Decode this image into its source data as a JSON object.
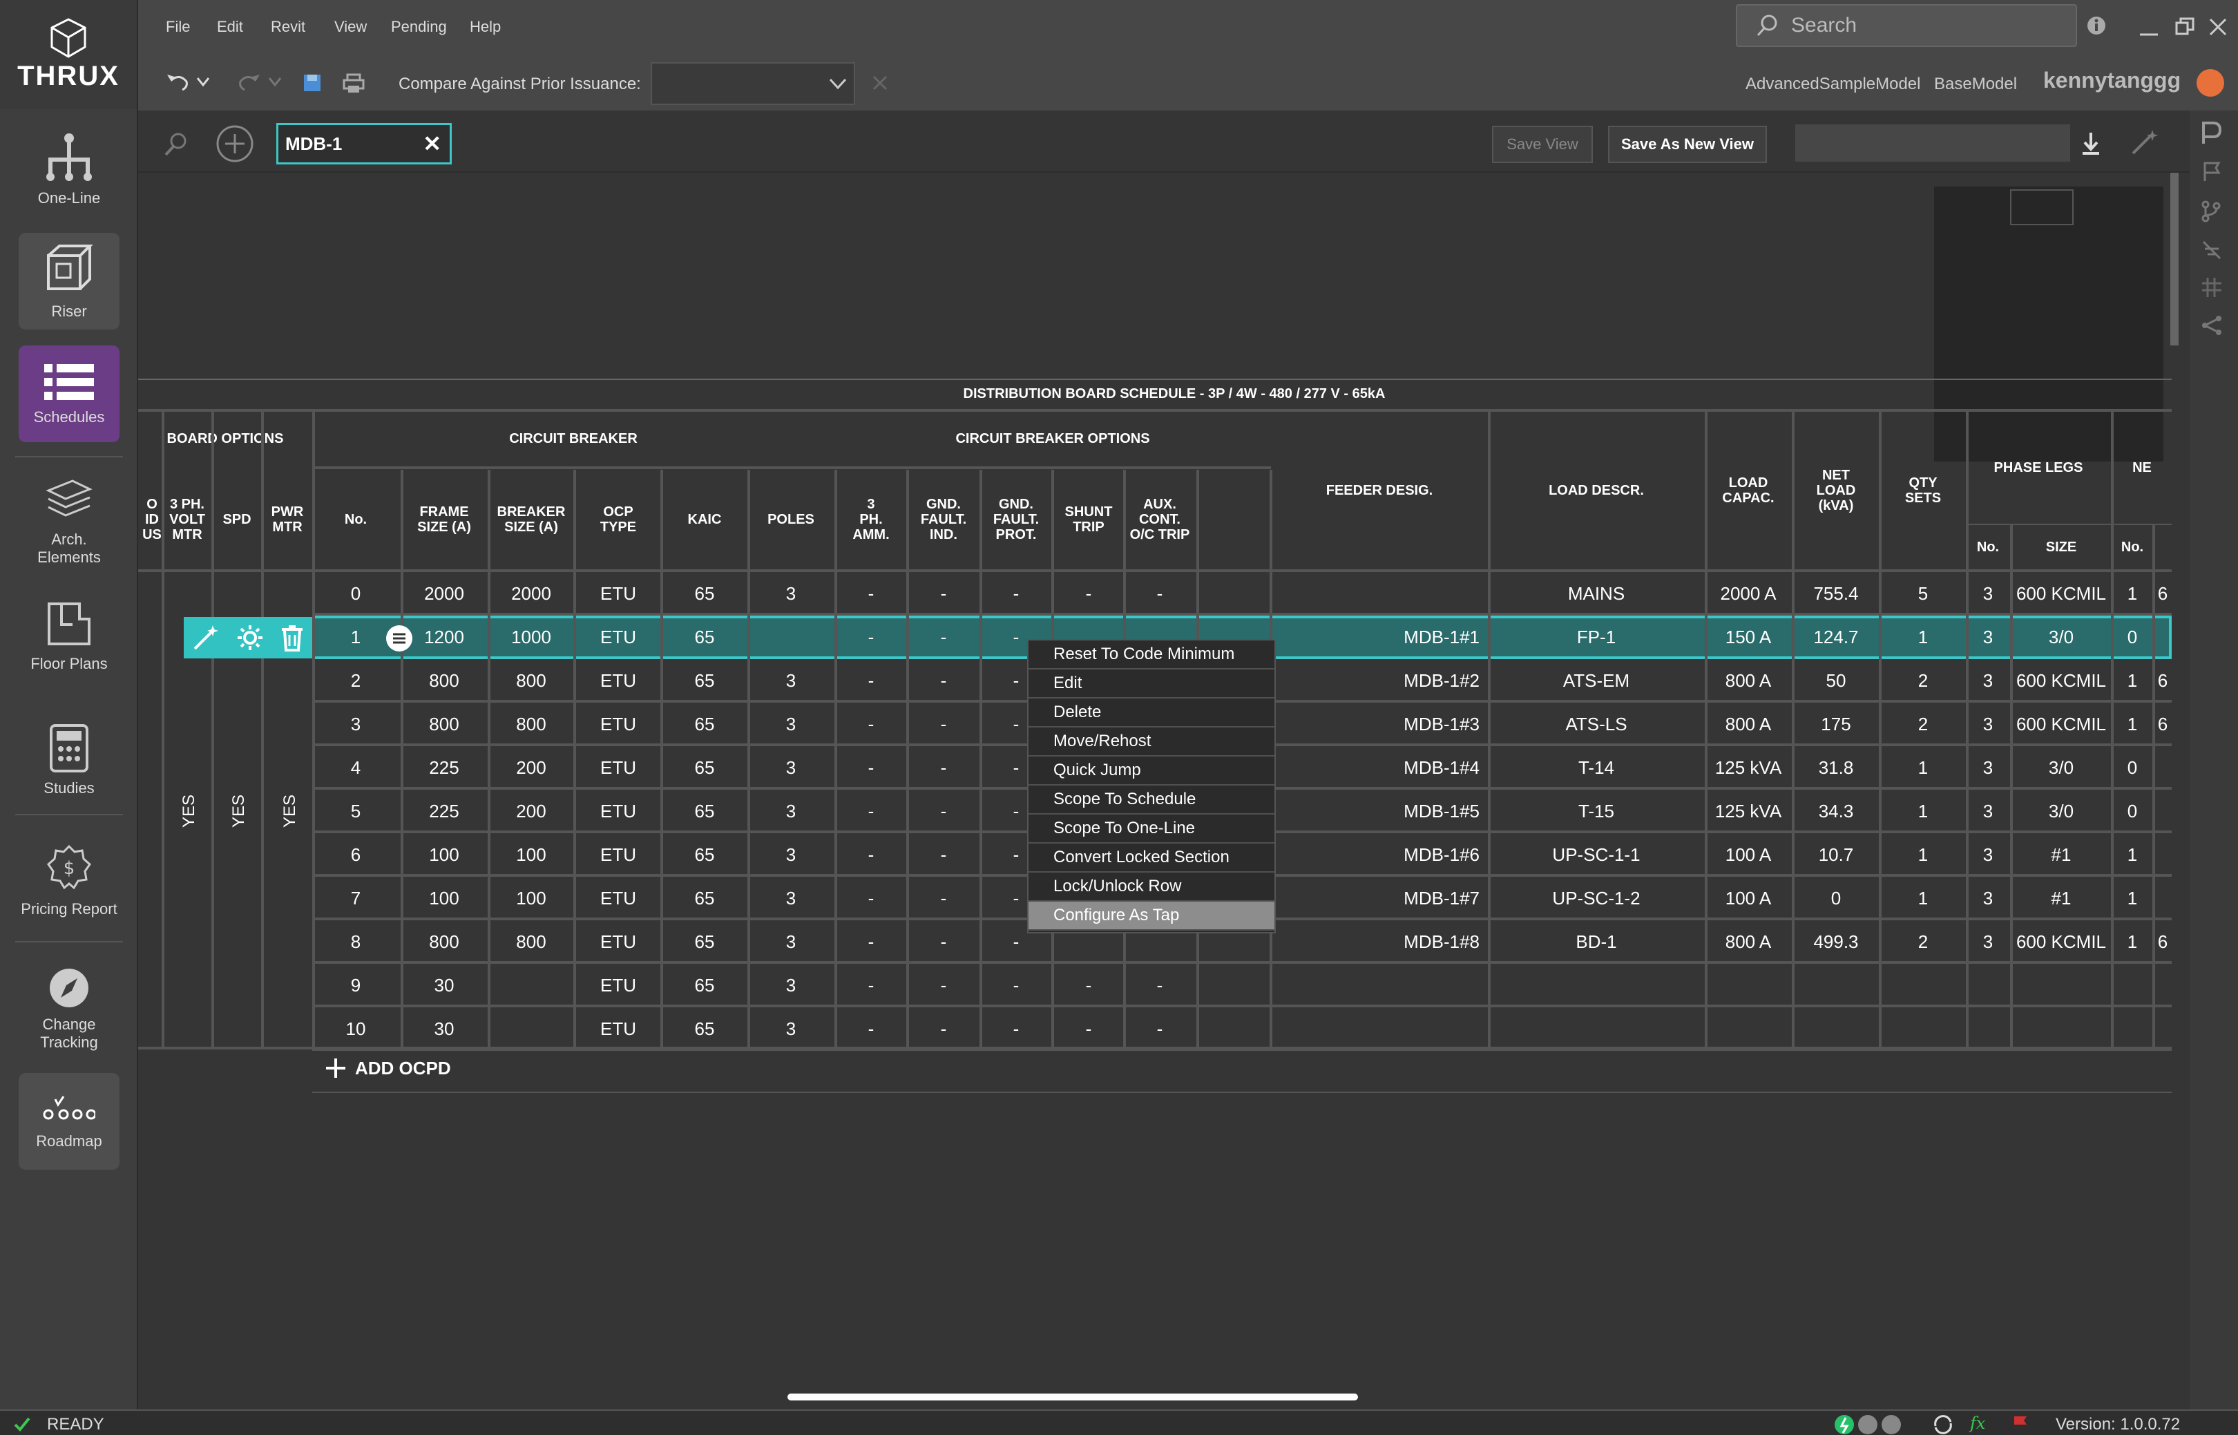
{
  "app": {
    "logo": "THRUX"
  },
  "nav": [
    {
      "label": "One-Line",
      "icon": "one-line-icon"
    },
    {
      "label": "Riser",
      "icon": "riser-cube-icon"
    },
    {
      "label": "Schedules",
      "icon": "schedules-list-icon"
    },
    {
      "label": "Arch. Elements",
      "icon": "arch-layers-icon"
    },
    {
      "label": "Floor Plans",
      "icon": "floor-plans-icon"
    },
    {
      "label": "Studies",
      "icon": "calculator-icon"
    },
    {
      "label": "Pricing Report",
      "icon": "pricing-icon"
    },
    {
      "label": "Change Tracking",
      "icon": "compass-icon"
    },
    {
      "label": "Roadmap",
      "icon": "roadmap-icon"
    }
  ],
  "menu": [
    "File",
    "Edit",
    "Revit",
    "View",
    "Pending",
    "Help"
  ],
  "search": {
    "placeholder": "Search"
  },
  "toolbar": {
    "compare_label": "Compare Against Prior Issuance:",
    "model1": "AdvancedSampleModel",
    "model2": "BaseModel",
    "user": "kennytanggg"
  },
  "view": {
    "tab": "MDB-1",
    "save_view": "Save View",
    "save_as_new_view": "Save As New View"
  },
  "schedule": {
    "title": "DISTRIBUTION BOARD SCHEDULE - 3P / 4W - 480 / 277 V - 65kA",
    "group_board_options": "BOARD OPTIONS",
    "group_circuit_breaker": "CIRCUIT BREAKER",
    "group_cb_options": "CIRCUIT BREAKER OPTIONS",
    "col_partial": "O\nID\nUS",
    "col_3ph_volt": "3 PH.\nVOLT\nMTR",
    "col_spd": "SPD",
    "col_pwr": "PWR\nMTR",
    "col_no": "No.",
    "col_frame": "FRAME\nSIZE (A)",
    "col_breaker": "BREAKER\nSIZE (A)",
    "col_ocp": "OCP\nTYPE",
    "col_kaic": "KAIC",
    "col_poles": "POLES",
    "col_3ph_amm": "3\nPH.\nAMM.",
    "col_gfi": "GND.\nFAULT.\nIND.",
    "col_gfp": "GND.\nFAULT.\nPROT.",
    "col_shunt": "SHUNT\nTRIP",
    "col_aux": "AUX.\nCONT.\nO/C TRIP",
    "col_feeder": "FEEDER DESIG.",
    "col_load_descr": "LOAD DESCR.",
    "col_load_capac": "LOAD\nCAPAC.",
    "col_net_load": "NET\nLOAD\n(kVA)",
    "col_qty": "QTY\nSETS",
    "col_phase_legs": "PHASE LEGS",
    "col_ne": "NE",
    "col_pl_no": "No.",
    "col_pl_size": "SIZE",
    "col_ne_no": "No.",
    "yes1": "YES",
    "yes2": "YES",
    "yes3": "YES",
    "rows": [
      {
        "no": "0",
        "frame": "2000",
        "breaker": "2000",
        "ocp": "ETU",
        "kaic": "65",
        "poles": "3",
        "amm": "-",
        "gfi": "-",
        "gfp": "-",
        "shunt": "-",
        "aux": "-",
        "feeder": "",
        "load": "MAINS",
        "capac": "2000 A",
        "net": "755.4",
        "qty": "5",
        "plno": "3",
        "plsize": "600 KCMIL",
        "neno": "1",
        "nesz": "6"
      },
      {
        "no": "1",
        "frame": "1200",
        "breaker": "1000",
        "ocp": "ETU",
        "kaic": "65",
        "poles": "",
        "amm": "-",
        "gfi": "-",
        "gfp": "-",
        "shunt": "",
        "aux": "",
        "feeder": "MDB-1#1",
        "load": "FP-1",
        "capac": "150 A",
        "net": "124.7",
        "qty": "1",
        "plno": "3",
        "plsize": "3/0",
        "neno": "0",
        "nesz": ""
      },
      {
        "no": "2",
        "frame": "800",
        "breaker": "800",
        "ocp": "ETU",
        "kaic": "65",
        "poles": "3",
        "amm": "-",
        "gfi": "-",
        "gfp": "-",
        "shunt": "",
        "aux": "",
        "feeder": "MDB-1#2",
        "load": "ATS-EM",
        "capac": "800 A",
        "net": "50",
        "qty": "2",
        "plno": "3",
        "plsize": "600 KCMIL",
        "neno": "1",
        "nesz": "6"
      },
      {
        "no": "3",
        "frame": "800",
        "breaker": "800",
        "ocp": "ETU",
        "kaic": "65",
        "poles": "3",
        "amm": "-",
        "gfi": "-",
        "gfp": "-",
        "shunt": "",
        "aux": "",
        "feeder": "MDB-1#3",
        "load": "ATS-LS",
        "capac": "800 A",
        "net": "175",
        "qty": "2",
        "plno": "3",
        "plsize": "600 KCMIL",
        "neno": "1",
        "nesz": "6"
      },
      {
        "no": "4",
        "frame": "225",
        "breaker": "200",
        "ocp": "ETU",
        "kaic": "65",
        "poles": "3",
        "amm": "-",
        "gfi": "-",
        "gfp": "-",
        "shunt": "",
        "aux": "",
        "feeder": "MDB-1#4",
        "load": "T-14",
        "capac": "125 kVA",
        "net": "31.8",
        "qty": "1",
        "plno": "3",
        "plsize": "3/0",
        "neno": "0",
        "nesz": ""
      },
      {
        "no": "5",
        "frame": "225",
        "breaker": "200",
        "ocp": "ETU",
        "kaic": "65",
        "poles": "3",
        "amm": "-",
        "gfi": "-",
        "gfp": "-",
        "shunt": "",
        "aux": "",
        "feeder": "MDB-1#5",
        "load": "T-15",
        "capac": "125 kVA",
        "net": "34.3",
        "qty": "1",
        "plno": "3",
        "plsize": "3/0",
        "neno": "0",
        "nesz": ""
      },
      {
        "no": "6",
        "frame": "100",
        "breaker": "100",
        "ocp": "ETU",
        "kaic": "65",
        "poles": "3",
        "amm": "-",
        "gfi": "-",
        "gfp": "-",
        "shunt": "",
        "aux": "",
        "feeder": "MDB-1#6",
        "load": "UP-SC-1-1",
        "capac": "100 A",
        "net": "10.7",
        "qty": "1",
        "plno": "3",
        "plsize": "#1",
        "neno": "1",
        "nesz": ""
      },
      {
        "no": "7",
        "frame": "100",
        "breaker": "100",
        "ocp": "ETU",
        "kaic": "65",
        "poles": "3",
        "amm": "-",
        "gfi": "-",
        "gfp": "-",
        "shunt": "",
        "aux": "",
        "feeder": "MDB-1#7",
        "load": "UP-SC-1-2",
        "capac": "100 A",
        "net": "0",
        "qty": "1",
        "plno": "3",
        "plsize": "#1",
        "neno": "1",
        "nesz": ""
      },
      {
        "no": "8",
        "frame": "800",
        "breaker": "800",
        "ocp": "ETU",
        "kaic": "65",
        "poles": "3",
        "amm": "-",
        "gfi": "-",
        "gfp": "-",
        "shunt": "",
        "aux": "",
        "feeder": "MDB-1#8",
        "load": "BD-1",
        "capac": "800 A",
        "net": "499.3",
        "qty": "2",
        "plno": "3",
        "plsize": "600 KCMIL",
        "neno": "1",
        "nesz": "6"
      },
      {
        "no": "9",
        "frame": "30",
        "breaker": "",
        "ocp": "ETU",
        "kaic": "65",
        "poles": "3",
        "amm": "-",
        "gfi": "-",
        "gfp": "-",
        "shunt": "-",
        "aux": "-",
        "feeder": "",
        "load": "",
        "capac": "",
        "net": "",
        "qty": "",
        "plno": "",
        "plsize": "",
        "neno": "",
        "nesz": ""
      },
      {
        "no": "10",
        "frame": "30",
        "breaker": "",
        "ocp": "ETU",
        "kaic": "65",
        "poles": "3",
        "amm": "-",
        "gfi": "-",
        "gfp": "-",
        "shunt": "-",
        "aux": "-",
        "feeder": "",
        "load": "",
        "capac": "",
        "net": "",
        "qty": "",
        "plno": "",
        "plsize": "",
        "neno": "",
        "nesz": ""
      }
    ],
    "add_ocpd": "ADD OCPD"
  },
  "context_menu": [
    "Reset To Code Minimum",
    "Edit",
    "Delete",
    "Move/Rehost",
    "Quick Jump",
    "Scope To Schedule",
    "Scope To One-Line",
    "Convert Locked Section",
    "Lock/Unlock Row",
    "Configure As Tap"
  ],
  "status": {
    "ready": "READY",
    "version": "Version: 1.0.0.72"
  },
  "colors": {
    "accent": "#3cc8c8",
    "schedules_active": "#6b3d86",
    "avatar": "#e8703a"
  }
}
